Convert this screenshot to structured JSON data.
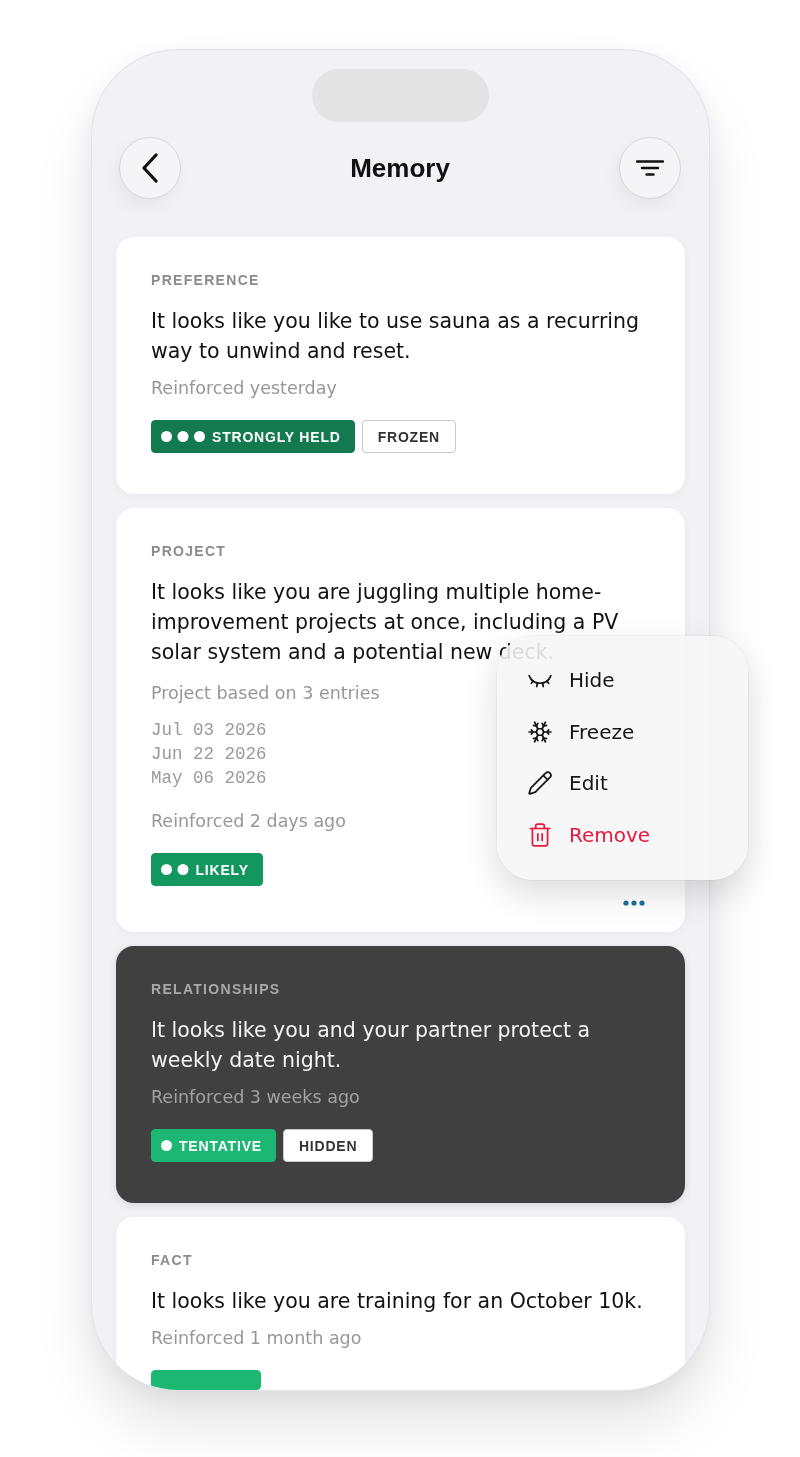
{
  "screen": {
    "title": "Memory"
  },
  "memories": [
    {
      "category": "PREFERENCE",
      "text": "It looks like you like to use sauna as a recurring way to unwind and reset.",
      "reinforced": "Reinforced yesterday",
      "hidden": false,
      "tags": [
        {
          "kind": "strong",
          "label": "STRONGLY HELD"
        },
        {
          "kind": "plain",
          "label": "FROZEN"
        }
      ]
    },
    {
      "category": "PROJECT",
      "text": "It looks like you are juggling multiple home-improvement projects at once, including a PV solar system and a potential new deck.",
      "entries": {
        "summary": "Project based on 3 entries",
        "dates": [
          "Jul 03 2026",
          "Jun 22 2026",
          "May 06 2026"
        ]
      },
      "reinforced": "Reinforced 2 days ago",
      "hidden": false,
      "tags": [
        {
          "kind": "likely",
          "label": "LIKELY"
        }
      ],
      "menu": {
        "open": true,
        "items": [
          {
            "kind": "default",
            "label": "Hide"
          },
          {
            "kind": "default",
            "label": "Freeze"
          },
          {
            "kind": "default",
            "label": "Edit"
          },
          {
            "kind": "destructive",
            "label": "Remove"
          }
        ]
      }
    },
    {
      "category": "RELATIONSHIPS",
      "text": "It looks like you and your partner protect a weekly date night.",
      "reinforced": "Reinforced 3 weeks ago",
      "hidden": true,
      "tags": [
        {
          "kind": "tentative",
          "label": "TENTATIVE"
        },
        {
          "kind": "plain",
          "label": "HIDDEN"
        }
      ]
    },
    {
      "category": "FACT",
      "text": "It looks like you are training for an October 10k.",
      "reinforced": "Reinforced 1 month ago",
      "hidden": false,
      "tags": [
        {
          "kind": "tentative"
        }
      ]
    }
  ]
}
